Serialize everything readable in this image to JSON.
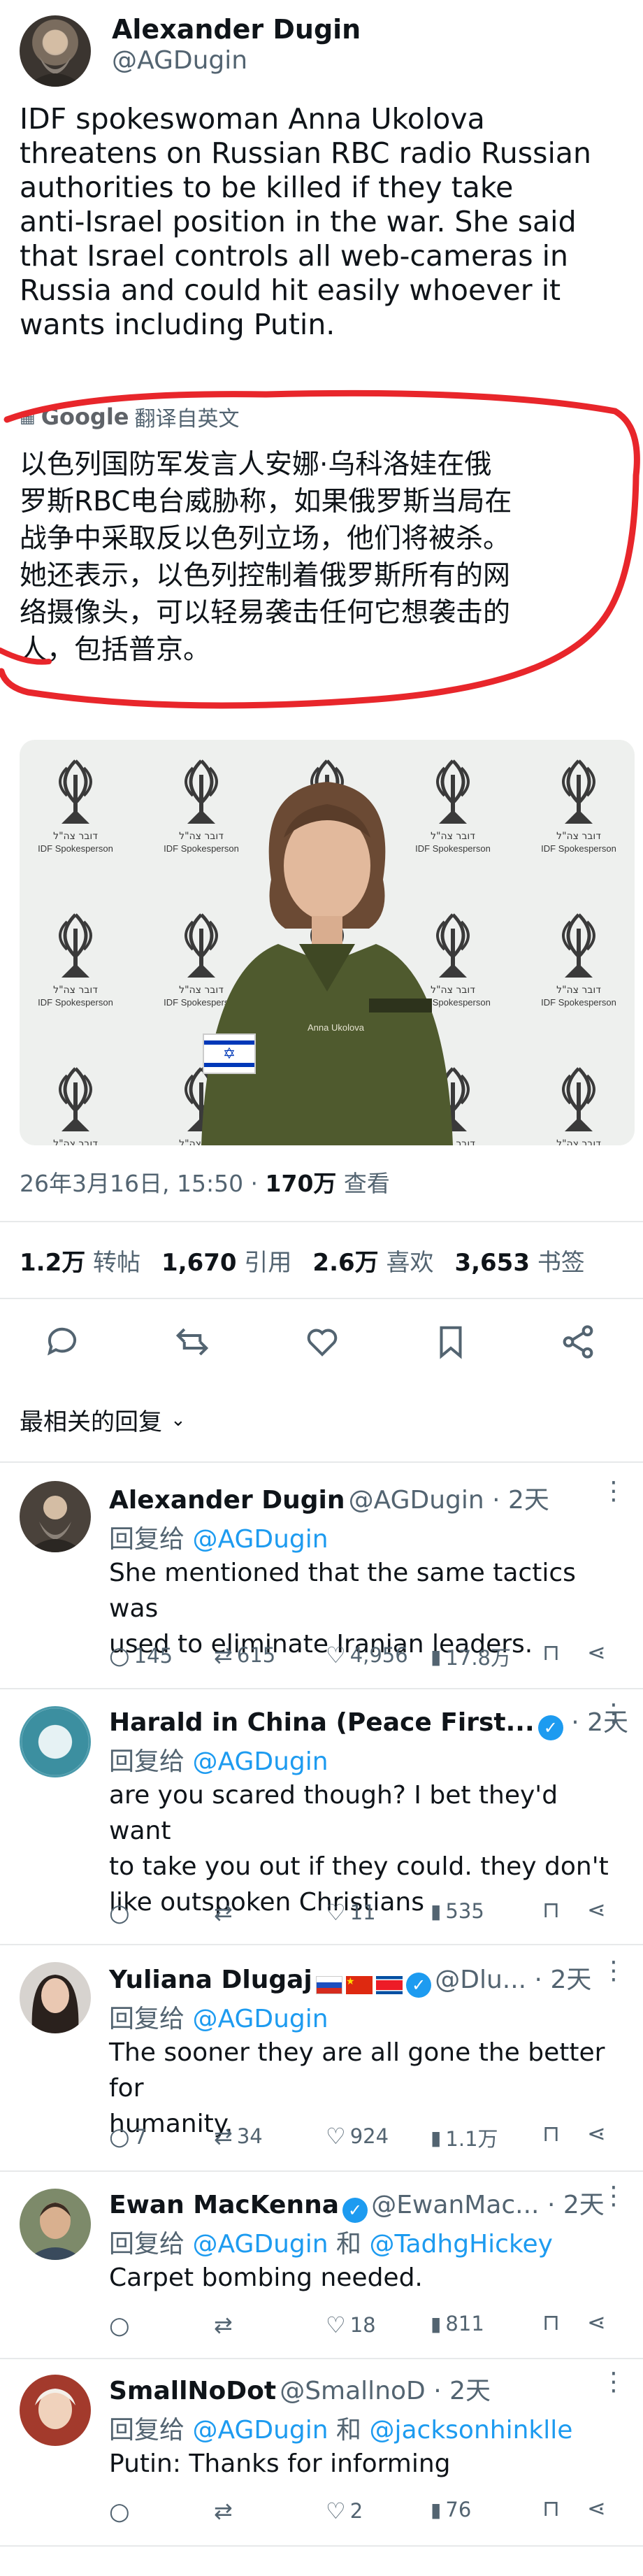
{
  "author": {
    "name": "Alexander Dugin",
    "handle": "@AGDugin"
  },
  "tweet": {
    "text_lines": [
      "IDF spokeswoman Anna Ukolova",
      "threatens on Russian RBC radio Russian",
      "authorities to be killed if they take",
      "anti-Israel position in the war. She said",
      "that Israel controls all web-cameras in",
      "Russia and could hit easily whoever  it",
      "wants including Putin."
    ],
    "translate_brand": "Google",
    "translate_label": "翻译自英文",
    "translation_lines": [
      "以色列国防军发言人安娜·乌科洛娃在俄",
      "罗斯RBC电台威胁称，如果俄罗斯当局在",
      "战争中采取反以色列立场，他们将被杀。",
      "她还表示，以色列控制着俄罗斯所有的网",
      "络摄像头，可以轻易袭击任何它想袭击的",
      "人，包括普京。"
    ],
    "image_sign_hebrew": "דובר צה\"ל",
    "image_sign_english": "IDF Spokesperson",
    "image_nametag": "Anna Ukolova",
    "timestamp": "26年3月16日, 15:50 · ",
    "views_count": "170万",
    "views_label": " 查看",
    "stats": [
      {
        "num": "1.2万",
        "label": "转帖"
      },
      {
        "num": "1,670",
        "label": "引用"
      },
      {
        "num": "2.6万",
        "label": "喜欢"
      },
      {
        "num": "3,653",
        "label": "书签"
      }
    ]
  },
  "replies_header": "最相关的回复",
  "reply_prefix": "回复给",
  "replies": [
    {
      "name": "Alexander Dugin",
      "handle": "@AGDugin",
      "time": " · 2天",
      "to": [
        "@AGDugin"
      ],
      "lines": [
        "She mentioned that the same tactics was",
        "used to eliminate Iranian leaders."
      ],
      "comments": "145",
      "retweets": "615",
      "likes": "4,956",
      "views": "17.8万"
    },
    {
      "name": "Harald in China (Peace First...",
      "handle": "",
      "time": " · 2天",
      "to": [
        "@AGDugin"
      ],
      "lines": [
        "are you scared though? I bet they'd want",
        "to take you out if they could. they don't",
        "like outspoken Christians"
      ],
      "comments": "",
      "retweets": "",
      "likes": "11",
      "views": "535"
    },
    {
      "name": "Yuliana Dlugaj",
      "handle": "@Dlu...",
      "time": " · 2天",
      "to": [
        "@AGDugin"
      ],
      "lines": [
        "The sooner they are all gone the better for",
        "humanity."
      ],
      "comments": "7",
      "retweets": "34",
      "likes": "924",
      "views": "1.1万"
    },
    {
      "name": "Ewan MacKenna",
      "handle": "@EwanMac...",
      "time": " · 2天",
      "to": [
        "@AGDugin",
        "@TadhgHickey"
      ],
      "lines": [
        "Carpet bombing needed."
      ],
      "comments": "",
      "retweets": "",
      "likes": "18",
      "views": "811"
    },
    {
      "name": "SmallNoDot",
      "handle": "@SmallnoD",
      "time": " · 2天",
      "to": [
        "@AGDugin",
        "@jacksonhinklle"
      ],
      "lines": [
        "Putin: Thanks for informing"
      ],
      "comments": "",
      "retweets": "",
      "likes": "2",
      "views": "76"
    }
  ],
  "reply_conj": " 和 ",
  "colors": {
    "accent": "#1d9bf0",
    "annotation_red": "#e8262b",
    "uniform_olive": "#4f5a2e"
  }
}
